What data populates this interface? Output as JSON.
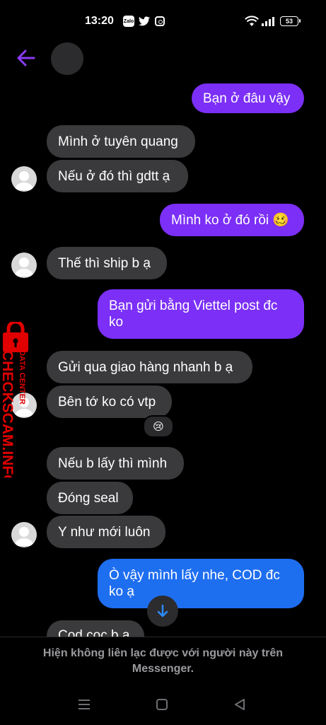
{
  "status_bar": {
    "time": "13:20",
    "app_icons": [
      "zalo-icon",
      "twitter-icon",
      "instagram-icon"
    ],
    "zalo_label": "Zalo",
    "battery": "53"
  },
  "header": {
    "back_icon": "arrow-left-icon",
    "accent_color": "#8b3bf5"
  },
  "messages": [
    {
      "side": "out",
      "text": "Bạn ở đâu vậy",
      "color": "#7b2ff7"
    },
    {
      "side": "in",
      "text": "Mình ở tuyên quang"
    },
    {
      "side": "in",
      "text": "Nếu ở đó thì gdtt ạ"
    },
    {
      "side": "out",
      "text": "Mình ko ở đó rồi 🥴",
      "color": "#7b2ff7"
    },
    {
      "side": "in",
      "text": "Thế thì ship b ạ"
    },
    {
      "side": "out",
      "text": "Bạn gửi bằng Viettel post đc ko",
      "color": "#7b2ff7"
    },
    {
      "side": "in",
      "text": "Gửi qua giao hàng nhanh b ạ"
    },
    {
      "side": "in",
      "text": "Bên tớ ko có vtp"
    },
    {
      "side": "in",
      "text": "Nếu b lấy thì mình"
    },
    {
      "side": "in",
      "text": "Đóng seal"
    },
    {
      "side": "in",
      "text": "Y như mới luôn"
    },
    {
      "side": "out",
      "text": "Ò vậy mình lấy nhe, COD đc ko ạ",
      "color": "#1e6ef0"
    },
    {
      "side": "in",
      "text": "Cod cọc b ạ"
    }
  ],
  "reaction": "😢",
  "footer": {
    "notice": "Hiện không liên lạc được với người này trên Messenger."
  },
  "watermark": {
    "brand": "CHECKSCAM.INFO",
    "sub": "DATA CENTER"
  },
  "nav_icons": [
    "menu-icon",
    "home-square-icon",
    "back-triangle-icon"
  ]
}
